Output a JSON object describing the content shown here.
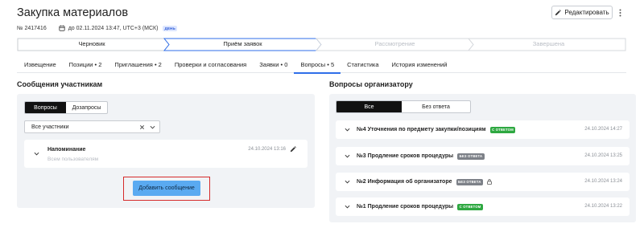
{
  "header": {
    "title": "Закупка материалов",
    "edit_label": "Редактировать",
    "more_icon": "more-vertical-icon",
    "number": "№ 2417416",
    "deadline": "до 02.11.2024 13:47, UTC+3 (МСК)",
    "day_badge": "ДЕНЬ"
  },
  "stepper": {
    "steps": [
      {
        "label": "Черновик",
        "state": "done"
      },
      {
        "label": "Приём заявок",
        "state": "active"
      },
      {
        "label": "Рассмотрение",
        "state": "pending"
      },
      {
        "label": "Завершена",
        "state": "pending"
      }
    ],
    "colors": {
      "active_border": "#2f6ee9",
      "done_text": "#1f1f1f",
      "pending_text": "#b9bdc4"
    }
  },
  "tabs": [
    {
      "label": "Извещение"
    },
    {
      "label": "Позиции • 2"
    },
    {
      "label": "Приглашения • 2"
    },
    {
      "label": "Проверки и согласования"
    },
    {
      "label": "Заявки • 0"
    },
    {
      "label": "Вопросы • 5",
      "active": true
    },
    {
      "label": "Статистика"
    },
    {
      "label": "История изменений"
    }
  ],
  "messages": {
    "title": "Сообщения участникам",
    "toggle": [
      "Вопросы",
      "Дозапросы"
    ],
    "filter_value": "Все участники",
    "card": {
      "title": "Напоминание",
      "subtitle": "Всем пользователям",
      "time": "24.10.2024 13:16"
    },
    "add_label": "Добавить сообщение"
  },
  "questions": {
    "title": "Вопросы организатору",
    "toggle": [
      "Все",
      "Без ответа"
    ],
    "items": [
      {
        "title": "№4 Уточнения по предмету закупки/позициям",
        "badge": "С ОТВЕТОМ",
        "badge_color": "green",
        "time": "24.10.2024 14:27",
        "lock": false
      },
      {
        "title": "№3 Продление сроков процедуры",
        "badge": "БЕЗ ОТВЕТА",
        "badge_color": "gray",
        "time": "24.10.2024 13:25",
        "lock": false
      },
      {
        "title": "№2 Информация об организаторе",
        "badge": "БЕЗ ОТВЕТА",
        "badge_color": "gray",
        "time": "24.10.2024 13:24",
        "lock": true
      },
      {
        "title": "№1 Продление сроков процедуры",
        "badge": "С ОТВЕТОМ",
        "badge_color": "green",
        "time": "24.10.2024 13:22",
        "lock": false
      }
    ]
  },
  "colors": {
    "accent": "#2f6ee9",
    "button": "#5aaaf1",
    "highlight": "#d62b2b",
    "panel": "#f1f3f6"
  }
}
